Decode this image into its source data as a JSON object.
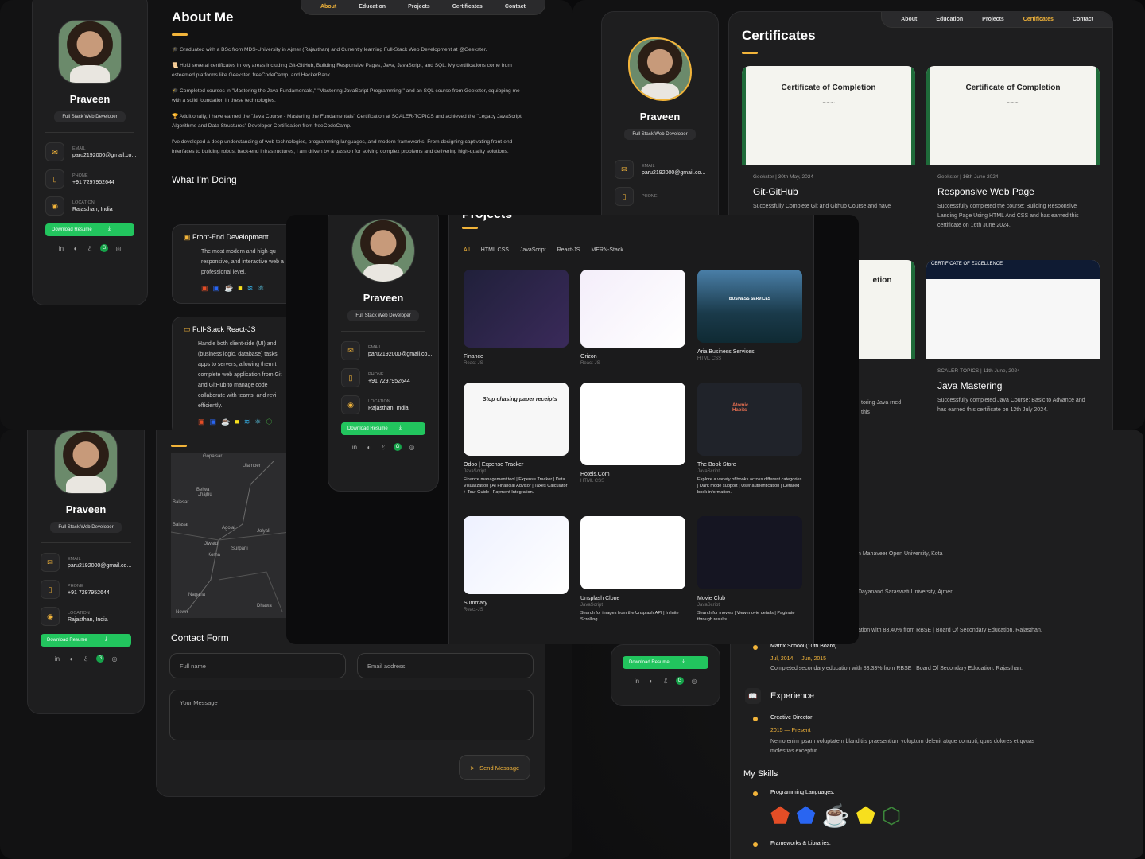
{
  "profile": {
    "name": "Praveen",
    "role": "Full Stack Web Developer",
    "email_label": "EMAIL",
    "email": "paru2192000@gmail.co...",
    "phone_label": "PHONE",
    "phone": "+91 7297952644",
    "location_label": "LOCATION",
    "location": "Rajasthan, India",
    "download": "Download Resume"
  },
  "nav": {
    "about": "About",
    "education": "Education",
    "projects": "Projects",
    "certificates": "Certificates",
    "contact": "Contact"
  },
  "about": {
    "title": "About Me",
    "p1": "🎓 Graduated with a BSc from MDS-University in Ajmer (Rajasthan) and Currently learning Full-Stack Web Development at @Geekster.",
    "p2": "📜 Hold several certificates in key areas including Git-GitHub, Building Responsive Pages, Java, JavaScript, and SQL. My certifications come from esteemed platforms like Geekster, freeCodeCamp, and HackerRank.",
    "p3": "🎓 Completed courses in \"Mastering the Java Fundamentals,\" \"Mastering JavaScript Programming,\" and an SQL course from Geekster, equipping me with a solid foundation in these technologies.",
    "p4": "🏆 Additionally, I have earned the \"Java Course - Mastering the Fundamentals\" Certification at SCALER-TOPICS and achieved the \"Legacy JavaScript Algorithms and Data Structures\" Developer Certification from freeCodeCamp.",
    "p5": "I've developed a deep understanding of web technologies, programming languages, and modern frameworks. From designing captivating front-end interfaces to building robust back-end infrastructures, I am driven by a passion for solving complex problems and delivering high-quality solutions.",
    "doing_title": "What I'm Doing",
    "svc1_title": "Front-End Development",
    "svc1_desc": "The most modern and high-qu responsive, and interactive web a professional level.",
    "svc2_title": "Full-Stack React-JS",
    "svc2_desc": "Handle both client-side (UI) and (business logic, database) tasks, apps to servers, allowing them t complete web application from Git and GitHub to manage code collaborate with teams, and revi efficiently."
  },
  "certificates": {
    "title": "Certificates",
    "card_title": "Certificate of Completion",
    "c1_meta": "Geekster | 30th May, 2024",
    "c1_name": "Git-GitHub",
    "c1_desc": "Successfully Complete Git and Github Course and have",
    "c2_meta": "Geekster | 16th June 2024",
    "c2_name": "Responsive Web Page",
    "c2_desc": "Successfully completed the course: Building Responsive Landing Page Using HTML And CSS and has earned this certificate on 16th June 2024.",
    "c3_excellence": "CERTIFICATE OF EXCELLENCE",
    "c3_meta": "SCALER-TOPICS | 11th June, 2024",
    "c3_name": "Java Mastering",
    "c3_desc": "Successfully completed Java Course: Basic to Advance and has earned this certificate on 12th July 2024.",
    "partial_title": "etion",
    "partial_desc": "toring Java rned this"
  },
  "projects": {
    "title": "Projects",
    "filters": [
      "All",
      "HTML CSS",
      "JavaScript",
      "React-JS",
      "MERN-Stack"
    ],
    "items": [
      {
        "title": "Finance",
        "cat": "React-JS",
        "desc": ""
      },
      {
        "title": "Orizon",
        "cat": "React-JS",
        "desc": ""
      },
      {
        "title": "Aria Business Services",
        "cat": "HTML CSS",
        "desc": ""
      },
      {
        "title": "Odoo | Expense Tracker",
        "cat": "JavaScript",
        "desc": "Finance management tool | Expense Tracker | Data Visualization | AI Financial Advisor | Taxes Calculator + Tour Guide | Payment Integration."
      },
      {
        "title": "Hotels.Com",
        "cat": "HTML CSS",
        "desc": ""
      },
      {
        "title": "The Book Store",
        "cat": "JavaScript",
        "desc": "Explore a variety of books across different categories | Dark mode support | User authentication | Detailed book information."
      },
      {
        "title": "Summary",
        "cat": "React-JS",
        "desc": ""
      },
      {
        "title": "Unsplash Clone",
        "cat": "JavaScript",
        "desc": "Search for images from the Unsplash API | Infinite Scrolling"
      },
      {
        "title": "Movie Club",
        "cat": "JavaScript",
        "desc": "Search for movies | View movie details | Paginate through results."
      }
    ],
    "thumb_texts": {
      "odoo": "Stop chasing paper receipts",
      "aria": "BUSINESS SERVICES",
      "book": "Atomic Habits"
    }
  },
  "contact": {
    "title": "Contact Form",
    "fullname_ph": "Full name",
    "email_ph": "Email address",
    "message_ph": "Your Message",
    "send": "Send Message"
  },
  "map": {
    "labels": [
      "Gopalsar",
      "Ulamber",
      "Belwa",
      "Balesar",
      "Jhajhu",
      "Balasar",
      "Agolai",
      "Jolyali",
      "Jiwatd",
      "Surpani",
      "Korna",
      "Nagana",
      "Dhawa",
      "Newri"
    ]
  },
  "resume": {
    "edu1_desc": "n Mahaveer Open University, Kota",
    "edu2_desc": "Dayanand Saraswati University, Ajmer",
    "edu3_desc": "ation with 83.40% from RBSE | Board Of Secondary Education, Rajasthan.",
    "edu4_title": "Matrix School (10th Board)",
    "edu4_date": "Jul, 2014 — Jun, 2015",
    "edu4_desc": "Completed secondary education with 83.33% from RBSE | Board Of Secondary Education, Rajasthan.",
    "exp_title": "Experience",
    "exp1_title": "Creative Director",
    "exp1_date": "2015 — Present",
    "exp1_desc": "Nemo enim ipsam voluptatem blanditiis praesentium voluptum delenit atque corrupti, quos dolores et qvuas molestias exceptur",
    "skills_title": "My Skills",
    "skills_sub1": "Programming Languages:",
    "skills_sub2": "Frameworks & Libraries:"
  },
  "colors": {
    "accent": "#f2b43a",
    "green": "#22c55e",
    "bg": "#121213"
  }
}
